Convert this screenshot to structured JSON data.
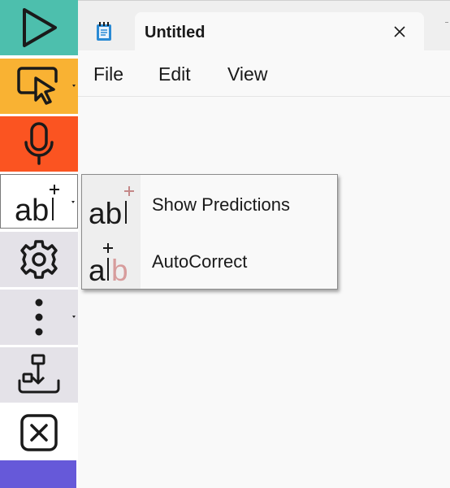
{
  "toolbar": {
    "items": [
      {
        "name": "play",
        "icon": "play-icon",
        "color": "#4dbfad"
      },
      {
        "name": "select",
        "icon": "cursor-select-icon",
        "color": "#f9b233"
      },
      {
        "name": "dictation",
        "icon": "microphone-icon",
        "color": "#fb5421"
      },
      {
        "name": "predictions",
        "icon": "text-predict-icon",
        "color": "#ffffff"
      },
      {
        "name": "settings",
        "icon": "gear-icon",
        "color": "#e4e2e8"
      },
      {
        "name": "more",
        "icon": "vertical-ellipsis-icon",
        "color": "#e4e2e8"
      },
      {
        "name": "download",
        "icon": "download-tray-icon",
        "color": "#e4e2e8"
      },
      {
        "name": "close",
        "icon": "close-box-icon",
        "color": "#ffffff"
      }
    ]
  },
  "window": {
    "tab_title": "Untitled",
    "tab_icon": "notepad-icon",
    "menu": [
      "File",
      "Edit",
      "View"
    ]
  },
  "popup": {
    "items": [
      {
        "label": "Show Predictions",
        "icon": "predictions-icon"
      },
      {
        "label": "AutoCorrect",
        "icon": "autocorrect-icon"
      }
    ]
  },
  "colors": {
    "accent_purple": "#6659d9",
    "autocorrect_tint": "#d79c9c"
  }
}
